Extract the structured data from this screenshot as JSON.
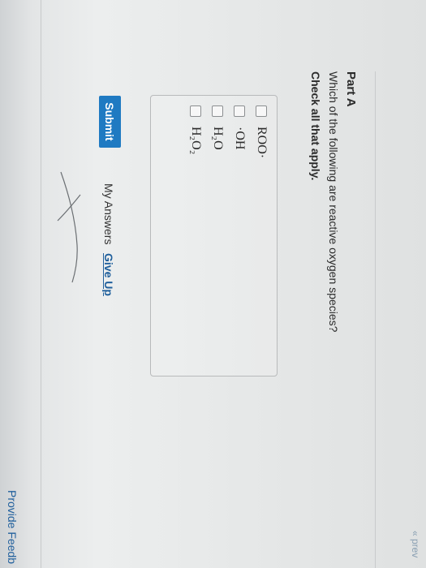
{
  "header": {
    "prev_label": "« prev"
  },
  "part": {
    "title": "Part A",
    "question": "Which of the following are reactive oxygen species?",
    "instruction": "Check all that apply."
  },
  "options": [
    {
      "label": "ROO·",
      "checked": false
    },
    {
      "label": "·OH",
      "checked": false
    },
    {
      "label": "H₂O",
      "checked": false
    },
    {
      "label": "H₂O₂",
      "checked": false
    }
  ],
  "actions": {
    "submit_label": "Submit",
    "my_answers_label": "My Answers",
    "give_up_label": "Give Up"
  },
  "footer": {
    "feedback_label": "Provide Feedb"
  },
  "colors": {
    "submit_bg": "#1f7ac2",
    "link": "#1f5f9c"
  }
}
